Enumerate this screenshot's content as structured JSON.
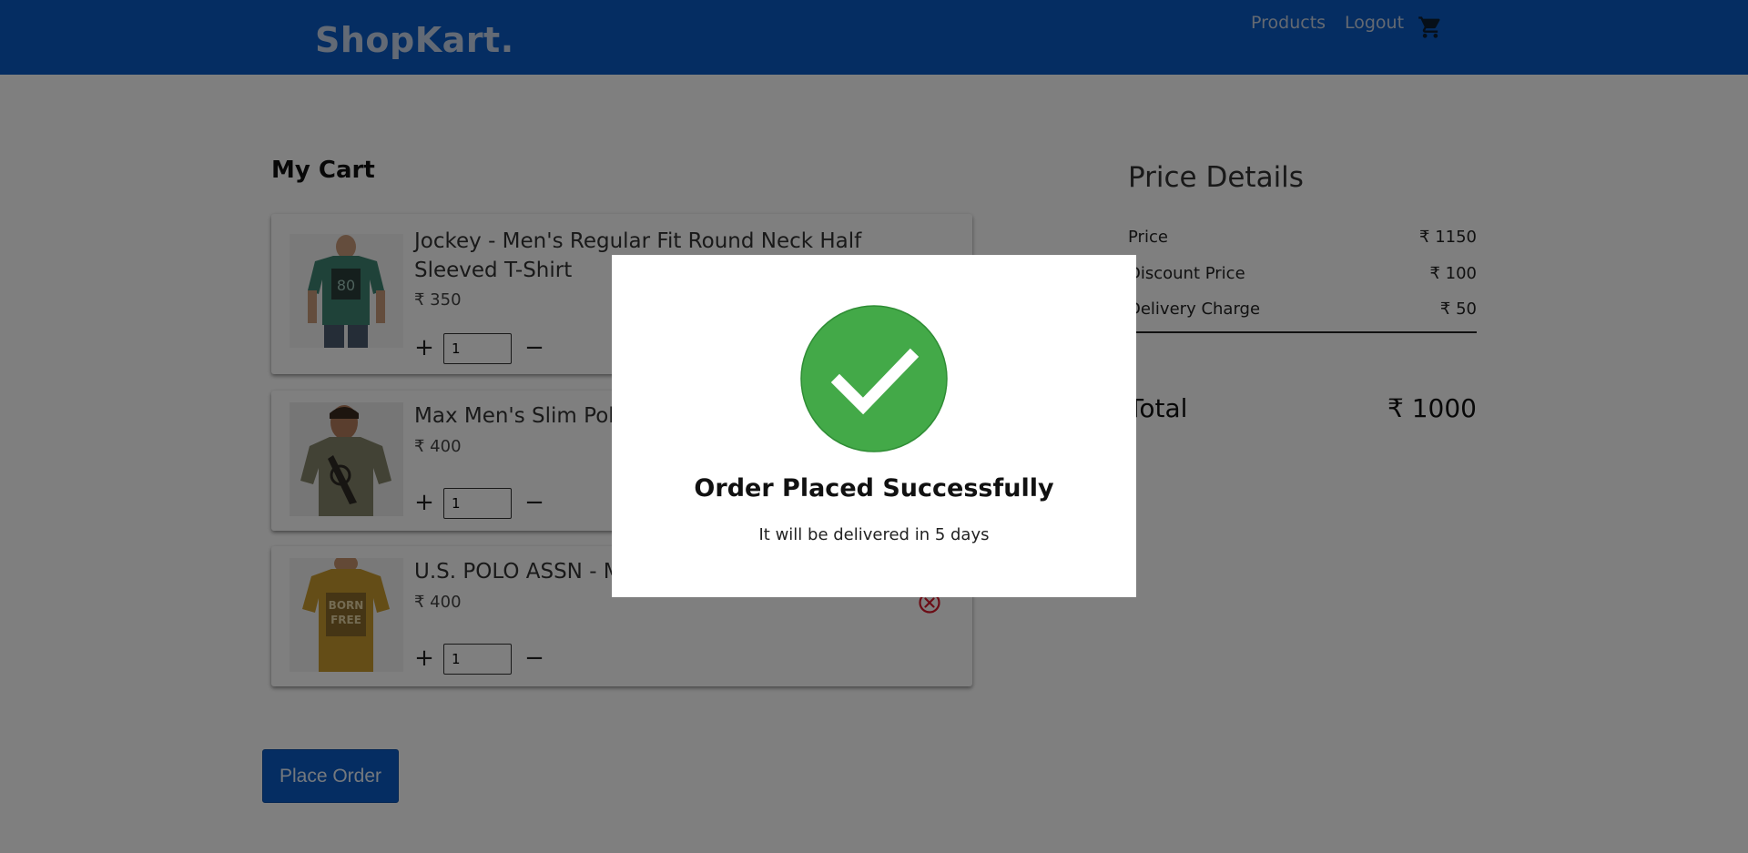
{
  "navbar": {
    "brand": "ShopKart.",
    "products_label": "Products",
    "logout_label": "Logout",
    "cart_icon": "shopping-cart-icon"
  },
  "cart": {
    "title": "My Cart",
    "items": [
      {
        "name": "Jockey - Men's Regular Fit Round Neck Half Sleeved T-Shirt",
        "price": "₹ 350",
        "quantity": "1"
      },
      {
        "name": "Max Men's Slim Polo",
        "price": "₹ 400",
        "quantity": "1"
      },
      {
        "name": "U.S. POLO ASSN - M",
        "price": "₹ 400",
        "quantity": "1"
      }
    ],
    "plus_symbol": "+",
    "minus_symbol": "−",
    "remove_icon": "remove-circle-icon"
  },
  "price_details": {
    "title": "Price Details",
    "rows": [
      {
        "label": "Price",
        "value": "₹ 1150"
      },
      {
        "label": "Discount Price",
        "value": "₹ 100"
      },
      {
        "label": "Delivery Charge",
        "value": "₹ 50"
      }
    ],
    "total_label": "Total",
    "total_value": "₹ 1000"
  },
  "actions": {
    "place_order_label": "Place Order"
  },
  "modal": {
    "title": "Order Placed Successfully",
    "subtitle": "It will be delivered in 5 days",
    "icon": "success-check-icon"
  },
  "colors": {
    "navbar": "#0a5bc4",
    "success": "#43a948",
    "remove": "#d9192a",
    "overlay": "rgba(0,0,0,0.5)"
  }
}
